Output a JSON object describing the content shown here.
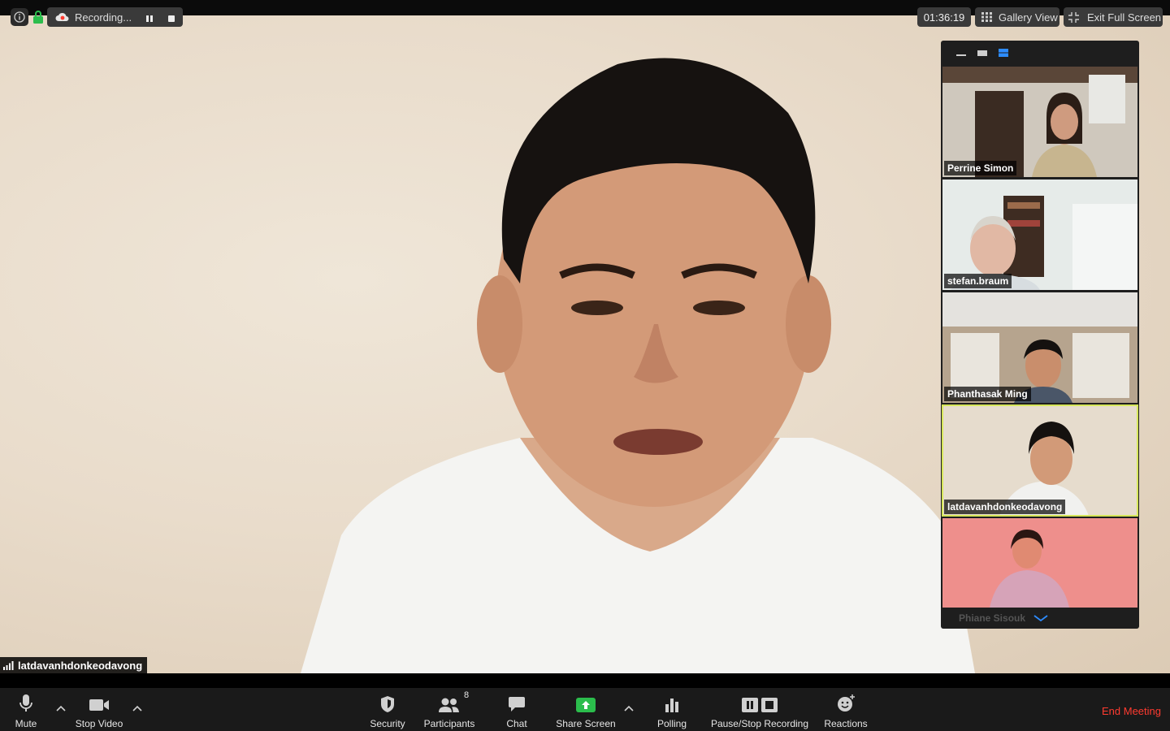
{
  "topbar": {
    "recording_label": "Recording...",
    "timer": "01:36:19",
    "gallery_view_label": "Gallery View",
    "exit_full_screen_label": "Exit Full Screen"
  },
  "main": {
    "speaker_name": "latdavanhdonkeodavong"
  },
  "thumbnails": [
    {
      "name": "Perrine Simon"
    },
    {
      "name": "stefan.braum"
    },
    {
      "name": "Phanthasak Ming"
    },
    {
      "name": "latdavanhdonkeodavong"
    },
    {
      "name": "Phiane Sisouk"
    }
  ],
  "toolbar": {
    "mute_label": "Mute",
    "stop_video_label": "Stop Video",
    "security_label": "Security",
    "participants_label": "Participants",
    "participants_count": "8",
    "chat_label": "Chat",
    "share_screen_label": "Share Screen",
    "polling_label": "Polling",
    "recording_label": "Pause/Stop Recording",
    "reactions_label": "Reactions",
    "end_meeting_label": "End Meeting"
  },
  "colors": {
    "end_meeting": "#ff3b30",
    "active_speaker_border": "#d6e65a",
    "share_screen_green": "#2bbd4c",
    "layout_active_blue": "#2d8cff"
  }
}
